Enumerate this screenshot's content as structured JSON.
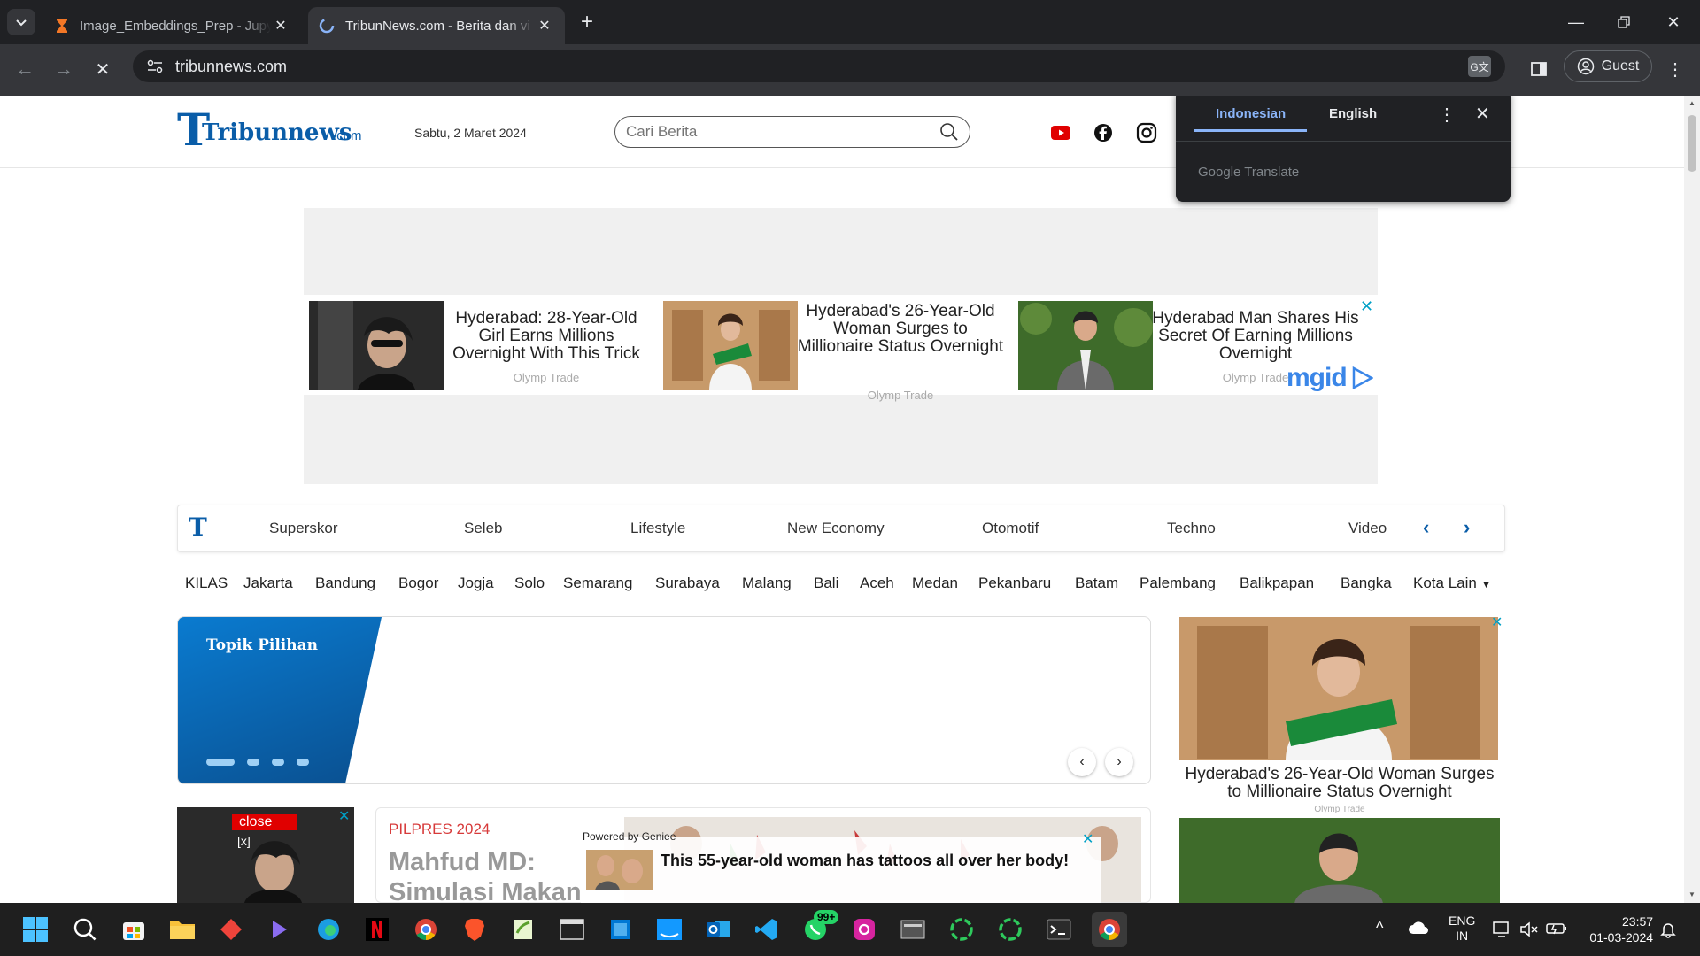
{
  "browser": {
    "tabs": [
      {
        "title": "Image_Embeddings_Prep - Jupyter",
        "active": false
      },
      {
        "title": "TribunNews.com - Berita dan vi",
        "active": true
      }
    ],
    "new_tab": "+",
    "url": "tribunnews.com",
    "profile_label": "Guest"
  },
  "translate_popup": {
    "source_lang": "Indonesian",
    "target_lang": "English",
    "brand": "Google Translate"
  },
  "header": {
    "logo_text": "Tribunnews",
    "logo_suffix": ".com",
    "date": "Sabtu, 2 Maret 2024",
    "search_placeholder": "Cari Berita"
  },
  "ad_widget": {
    "cards": [
      {
        "text": "Hyderabad: 28-Year-Old Girl Earns Millions Overnight With This Trick",
        "source": "Olymp Trade"
      },
      {
        "text": "Hyderabad's 26-Year-Old Woman Surges to Millionaire Status Overnight",
        "source": "Olymp Trade"
      },
      {
        "text": "Hyderabad Man Shares His Secret Of Earning Millions Overnight",
        "source": "Olymp Trade"
      }
    ],
    "network": "mgid"
  },
  "category_nav": {
    "logo": "T",
    "items": [
      "Superskor",
      "Seleb",
      "Lifestyle",
      "New Economy",
      "Otomotif",
      "Techno",
      "Video"
    ]
  },
  "region_nav": {
    "items": [
      "KILAS",
      "Jakarta",
      "Bandung",
      "Bogor",
      "Jogja",
      "Solo",
      "Semarang",
      "Surabaya",
      "Malang",
      "Bali",
      "Aceh",
      "Medan",
      "Pekanbaru",
      "Batam",
      "Palembang",
      "Balikpapan",
      "Bangka"
    ],
    "more": "Kota Lain"
  },
  "topik": {
    "title": "Topik Pilihan"
  },
  "side_ad": {
    "text": "Hyderabad's 26-Year-Old Woman Surges to Millionaire Status Overnight",
    "source": "Olymp Trade"
  },
  "small_ad": {
    "close_label": "close",
    "close_x": "[x]"
  },
  "news": {
    "tag": "PILPRES 2024",
    "headline": "Mahfud MD: Simulasi Makan"
  },
  "geniee": {
    "powered": "Powered by Geniee",
    "text": "This 55-year-old woman has tattoos all over her body!"
  },
  "taskbar": {
    "whatsapp_badge": "99+",
    "lang_line1": "ENG",
    "lang_line2": "IN",
    "time": "23:57",
    "date": "01-03-2024"
  },
  "colors": {
    "accent_blue": "#0a5da8",
    "chrome_dark": "#202124",
    "pilpres_red": "#d73a3a"
  }
}
